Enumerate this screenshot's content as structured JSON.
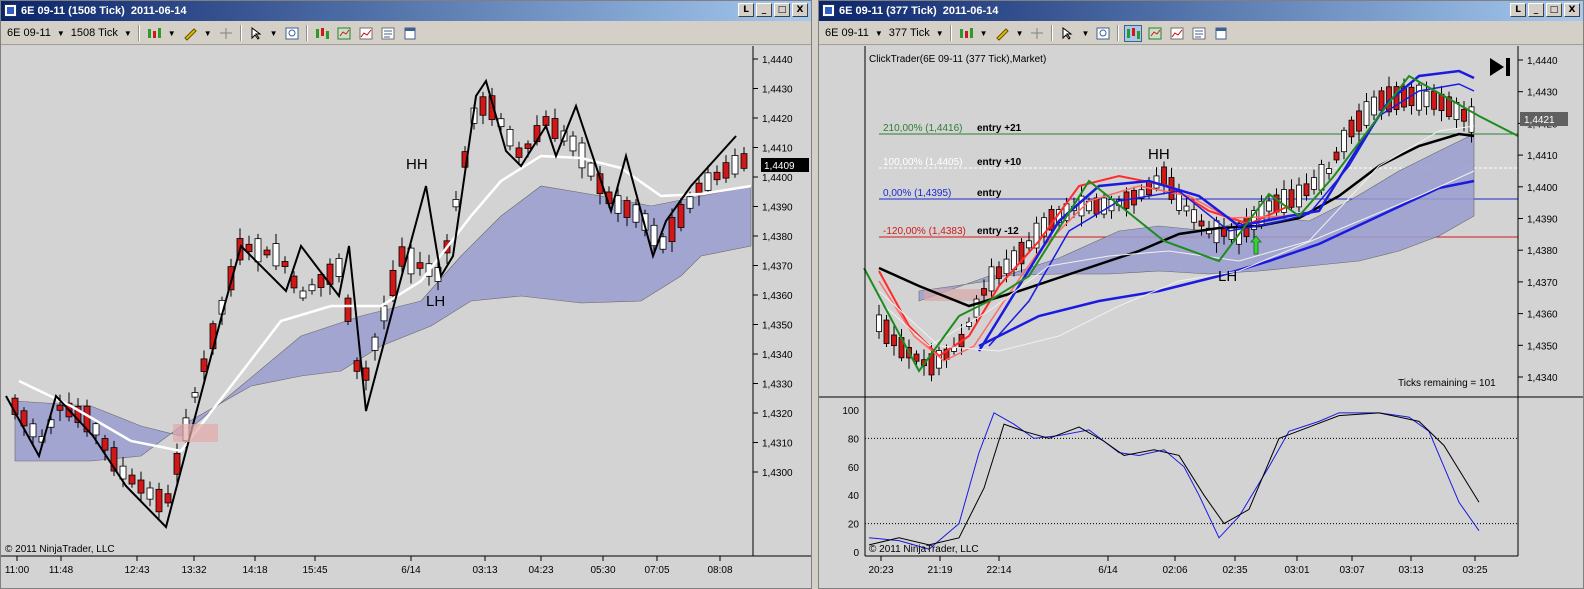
{
  "left": {
    "title": "6E 09-11 (1508 Tick)  2011-06-14",
    "instrument": "6E 09-11",
    "period": "1508 Tick",
    "win_buttons": [
      "L",
      "_",
      "□",
      "X"
    ],
    "price_ticks": [
      "1,4440",
      "1,4430",
      "1,4420",
      "1,4410",
      "1,4400",
      "1,4390",
      "1,4380",
      "1,4370",
      "1,4360",
      "1,4350",
      "1,4340",
      "1,4330",
      "1,4320",
      "1,4310",
      "1,4300"
    ],
    "last_price": "1,4409",
    "time_ticks": [
      "11:00",
      "11:48",
      "12:43",
      "13:32",
      "14:18",
      "15:45",
      "6/14",
      "03:13",
      "04:23",
      "05:30",
      "07:05",
      "08:08"
    ],
    "labels": {
      "hh": "HH",
      "lh": "LH"
    },
    "copyright": "© 2011 NinjaTrader, LLC"
  },
  "right": {
    "title": "6E 09-11 (377 Tick)  2011-06-14",
    "instrument": "6E 09-11",
    "period": "377 Tick",
    "win_buttons": [
      "L",
      "_",
      "□",
      "X"
    ],
    "chart_name": "ClickTrader(6E 09-11 (377 Tick),Market)",
    "price_ticks": [
      "1,4440",
      "1,4430",
      "1,4420",
      "1,4410",
      "1,4400",
      "1,4390",
      "1,4380",
      "1,4370",
      "1,4360",
      "1,4350",
      "1,4340"
    ],
    "last_price": "1,4421",
    "levels": [
      {
        "label": "210,00% (1,4416)",
        "text": "entry +21",
        "color": "#2e7d32"
      },
      {
        "label": "100,00% (1,4405)",
        "text": "entry +10",
        "color": "#ffffff"
      },
      {
        "label": "0,00% (1,4395)",
        "text": "entry",
        "color": "#1a2ad0"
      },
      {
        "label": "-120,00% (1,4383)",
        "text": "entry -12",
        "color": "#d01818"
      }
    ],
    "labels": {
      "hh": "HH",
      "lh": "LH"
    },
    "ticks_remaining": "Ticks remaining = 101",
    "osc_ticks": [
      "100",
      "80",
      "60",
      "40",
      "20",
      "0"
    ],
    "time_ticks": [
      "20:23",
      "21:19",
      "22:14",
      "6/14",
      "02:06",
      "02:35",
      "03:01",
      "03:07",
      "03:13",
      "03:25"
    ],
    "copyright": "© 2011 NinjaTrader, LLC"
  },
  "colors": {
    "title_start": "#0a246a",
    "title_end": "#a6caf0",
    "chart_bg": "#d3d3d3",
    "cloud": "#9a9ed0",
    "up_candle": "#ffffff",
    "down_candle": "#d01818"
  }
}
